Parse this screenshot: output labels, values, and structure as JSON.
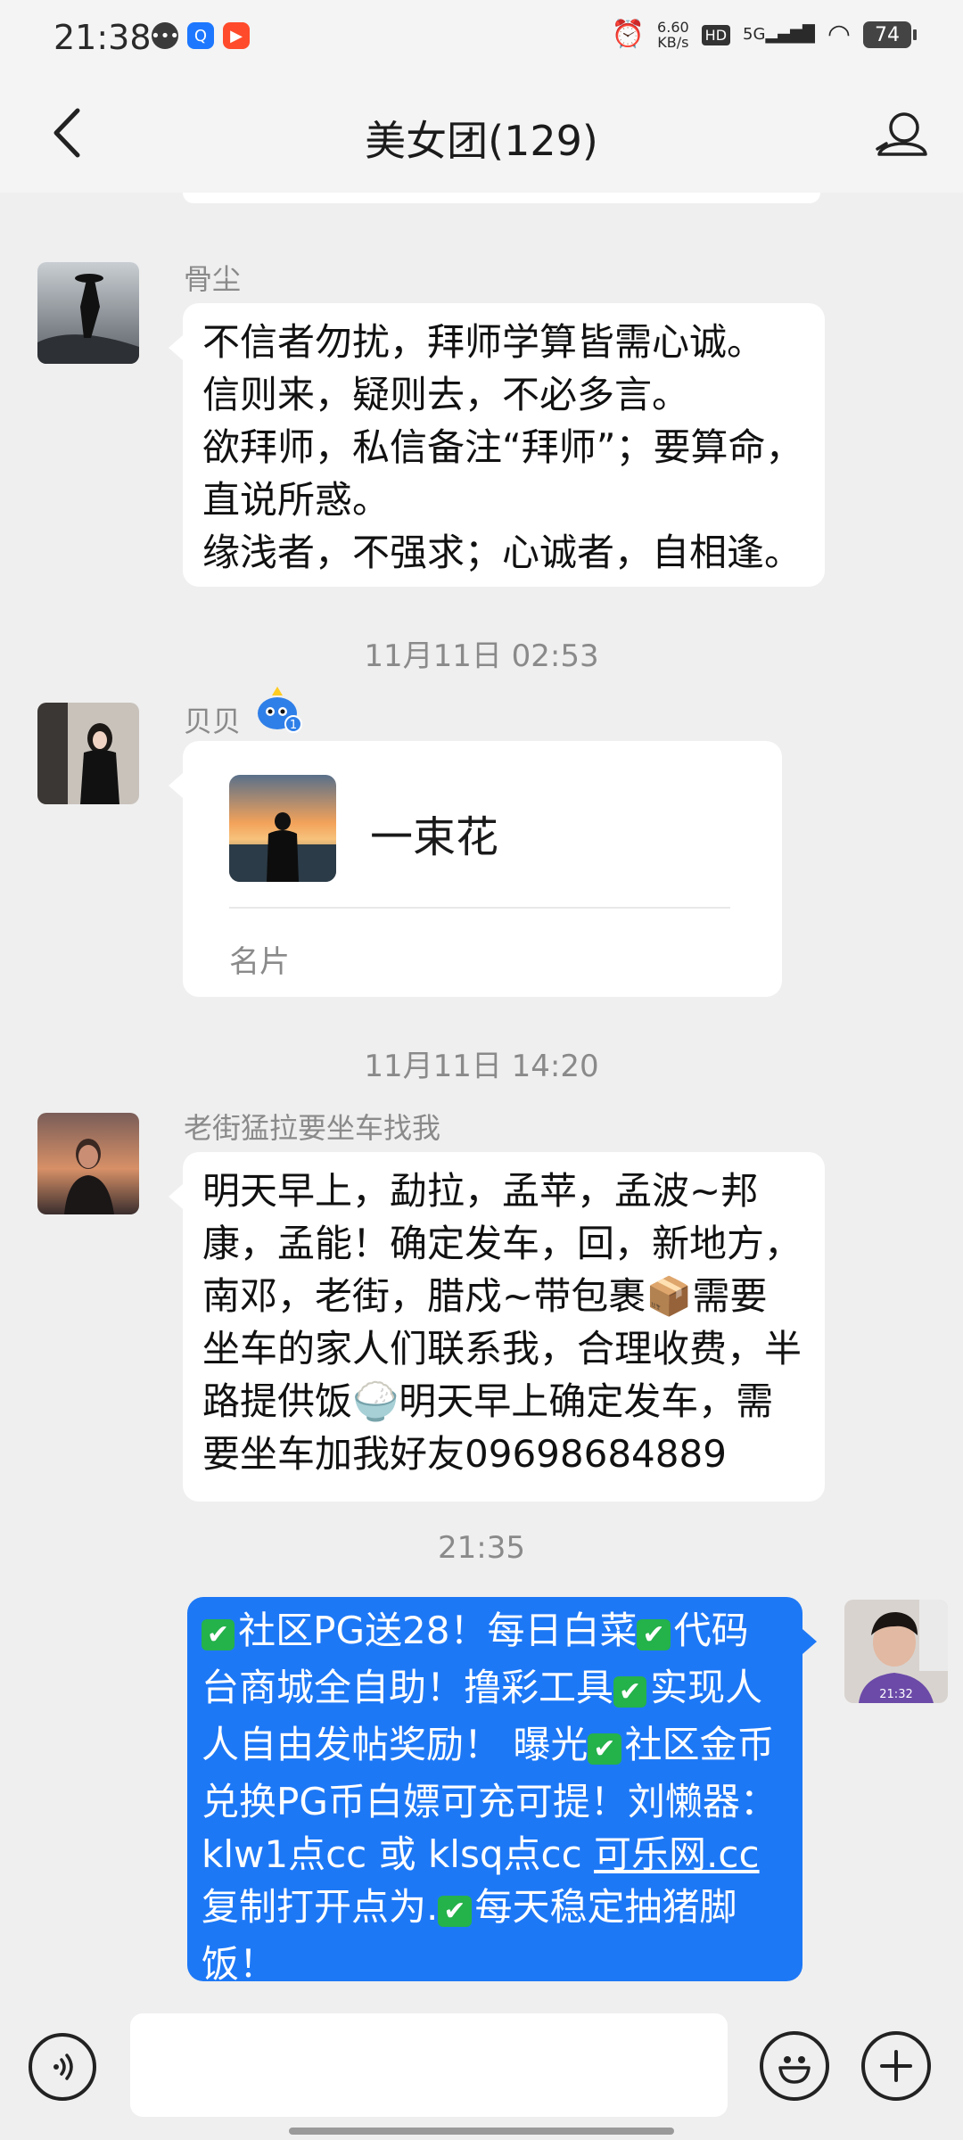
{
  "status_bar": {
    "time": "21:38",
    "speed_value": "6.60",
    "speed_unit": "KB/s",
    "hd": "HD",
    "network": "5G",
    "battery": "74"
  },
  "header": {
    "title": "美女团(129)"
  },
  "messages": [
    {
      "sender": "骨尘",
      "text": "不信者勿扰，拜师学算皆需心诚。\n信则来，疑则去，不必多言。\n欲拜师，私信备注“拜师”；要算命，直说所惑。\n缘浅者，不强求；心诚者，自相逢。"
    },
    {
      "timestamp": "11月11日 02:53"
    },
    {
      "sender": "贝贝",
      "badge_number": "1",
      "card": {
        "name": "一束花",
        "type": "名片"
      }
    },
    {
      "timestamp": "11月11日 14:20"
    },
    {
      "sender": "老街猛拉要坐车找我",
      "text": "明天早上，勐拉，孟苹，孟波~邦康，孟能！确定发车，回，新地方，南邓，老街，腊戍~带包裹📦需要坐车的家人们联系我，合理收费，半路提供饭🍚明天早上确定发车，需要坐车加我好友09698684889"
    },
    {
      "timestamp": "21:35"
    },
    {
      "mine": true,
      "segments": [
        "社区PG送28！每日白菜",
        "代码台商城全自助！撸彩工具",
        "实现人人自由发帖奖励！ 曝光",
        "社区金币兑换PG币白嫖可充可提！刘懒器： klw1点cc 或 klsq点cc ",
        "可乐网.cc",
        " 复制打开点为.",
        "每天稳定抽猪脚饭！"
      ],
      "avatar_caption": "21:32"
    }
  ],
  "colors": {
    "my_bubble": "#1d78f6",
    "background": "#efefef",
    "check": "#24b24b"
  }
}
